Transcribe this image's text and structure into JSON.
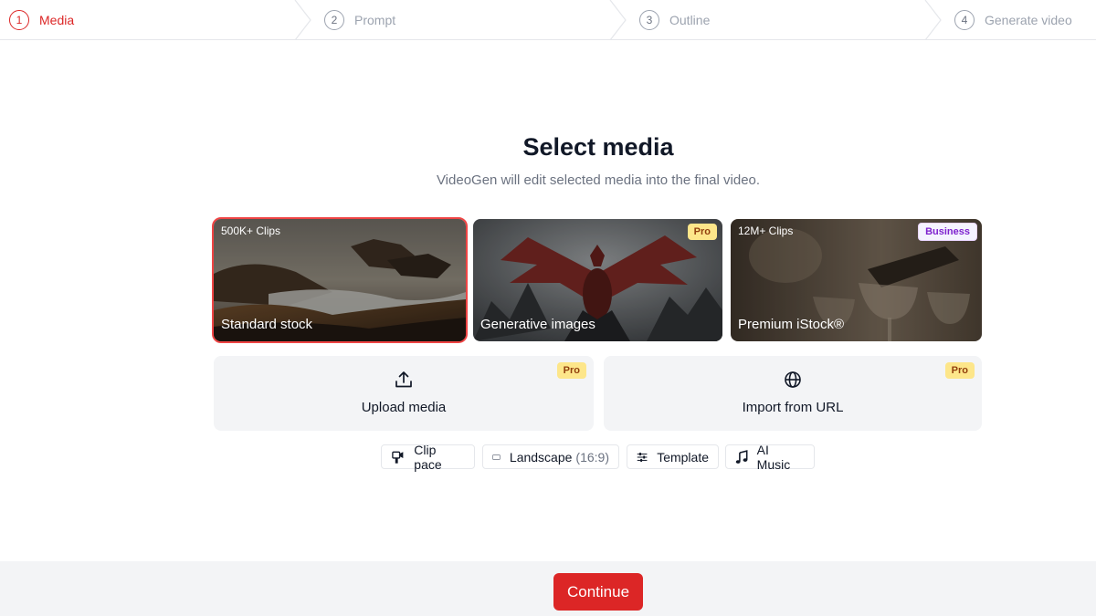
{
  "stepper": {
    "steps": [
      {
        "num": "1",
        "label": "Media",
        "active": true
      },
      {
        "num": "2",
        "label": "Prompt",
        "active": false
      },
      {
        "num": "3",
        "label": "Outline",
        "active": false
      },
      {
        "num": "4",
        "label": "Generate video",
        "active": false
      }
    ]
  },
  "main": {
    "title": "Select media",
    "subtitle": "VideoGen will edit selected media into the final video."
  },
  "media_cards": [
    {
      "name": "Standard stock",
      "count": "500K+ Clips",
      "badge": "",
      "selected": true
    },
    {
      "name": "Generative images",
      "count": "",
      "badge": "Pro",
      "selected": false
    },
    {
      "name": "Premium iStock®",
      "count": "12M+ Clips",
      "badge": "Business",
      "selected": false
    }
  ],
  "tiles": [
    {
      "label": "Upload media",
      "badge": "Pro",
      "icon": "upload-icon"
    },
    {
      "label": "Import from URL",
      "badge": "Pro",
      "icon": "globe-icon"
    }
  ],
  "options": {
    "clip_pace": {
      "label": "Clip pace",
      "icon": "clip-pace-icon"
    },
    "aspect": {
      "label": "Landscape",
      "detail": "(16:9)",
      "icon": "rectangle-icon"
    },
    "template": {
      "label": "Template",
      "icon": "sliders-icon"
    },
    "music": {
      "label": "AI Music",
      "icon": "music-note-icon"
    }
  },
  "footer": {
    "continue_label": "Continue"
  },
  "colors": {
    "accent": "#dc2626",
    "pro_badge": "#fde68a",
    "business_badge_text": "#7e22ce"
  }
}
